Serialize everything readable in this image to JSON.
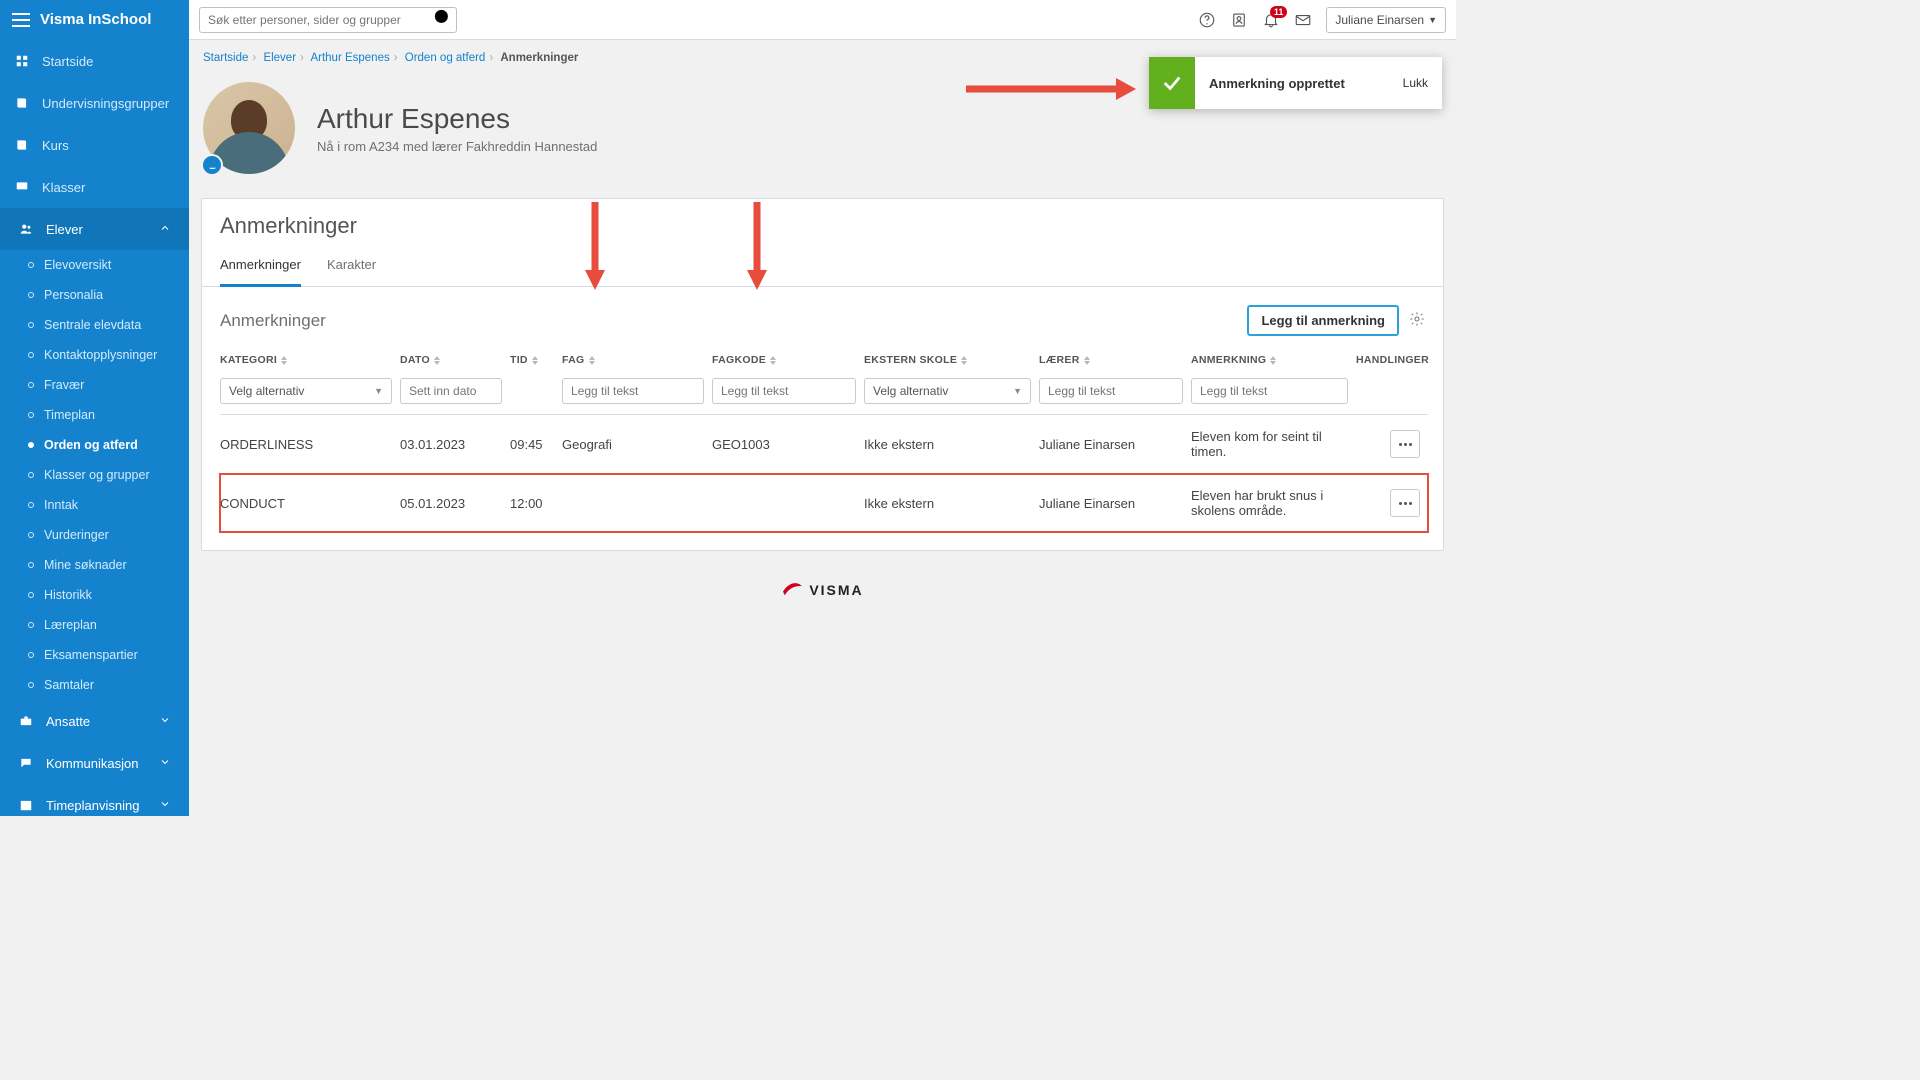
{
  "brand": "Visma InSchool",
  "search": {
    "placeholder": "Søk etter personer, sider og grupper"
  },
  "topbar": {
    "notification_count": "11",
    "user_name": "Juliane Einarsen"
  },
  "toast": {
    "message": "Anmerkning opprettet",
    "close": "Lukk"
  },
  "sidebar": {
    "top": [
      {
        "id": "startside",
        "label": "Startside",
        "icon": "grid"
      },
      {
        "id": "undervisningsgrupper",
        "label": "Undervisningsgrupper",
        "icon": "book"
      },
      {
        "id": "kurs",
        "label": "Kurs",
        "icon": "book"
      },
      {
        "id": "klasser",
        "label": "Klasser",
        "icon": "screen"
      }
    ],
    "elever_label": "Elever",
    "elever_sub": [
      {
        "id": "elevoversikt",
        "label": "Elevoversikt"
      },
      {
        "id": "personalia",
        "label": "Personalia"
      },
      {
        "id": "sentrale-elevdata",
        "label": "Sentrale elevdata"
      },
      {
        "id": "kontaktopplysninger",
        "label": "Kontaktopplysninger"
      },
      {
        "id": "fravaer",
        "label": "Fravær"
      },
      {
        "id": "timeplan",
        "label": "Timeplan"
      },
      {
        "id": "orden-og-atferd",
        "label": "Orden og atferd",
        "active": true
      },
      {
        "id": "klasser-og-grupper",
        "label": "Klasser og grupper"
      },
      {
        "id": "inntak",
        "label": "Inntak"
      },
      {
        "id": "vurderinger",
        "label": "Vurderinger"
      },
      {
        "id": "mine-soknader",
        "label": "Mine søknader"
      },
      {
        "id": "historikk",
        "label": "Historikk"
      },
      {
        "id": "laereplan",
        "label": "Læreplan"
      },
      {
        "id": "eksamenspartier",
        "label": "Eksamenspartier"
      },
      {
        "id": "samtaler",
        "label": "Samtaler"
      }
    ],
    "bottom": [
      {
        "id": "ansatte",
        "label": "Ansatte",
        "icon": "briefcase"
      },
      {
        "id": "kommunikasjon",
        "label": "Kommunikasjon",
        "icon": "chat"
      },
      {
        "id": "timeplanvisning",
        "label": "Timeplanvisning",
        "icon": "calendar"
      }
    ]
  },
  "breadcrumb": {
    "items": [
      "Startside",
      "Elever",
      "Arthur Espenes",
      "Orden og atferd"
    ],
    "current": "Anmerkninger"
  },
  "profile": {
    "name": "Arthur Espenes",
    "subtitle": "Nå i rom A234 med lærer Fakhreddin Hannestad"
  },
  "page_title": "Anmerkninger",
  "tabs": {
    "t0": "Anmerkninger",
    "t1": "Karakter"
  },
  "section": {
    "title": "Anmerkninger",
    "add_button": "Legg til anmerkning"
  },
  "table": {
    "headers": {
      "kategori": "KATEGORI",
      "dato": "DATO",
      "tid": "TID",
      "fag": "FAG",
      "fagkode": "FAGKODE",
      "ekstern": "EKSTERN SKOLE",
      "laerer": "LÆRER",
      "anmerkning": "ANMERKNING",
      "handlinger": "HANDLINGER"
    },
    "filters": {
      "select_placeholder": "Velg alternativ",
      "date_placeholder": "Sett inn dato",
      "text_placeholder": "Legg til tekst"
    },
    "rows": [
      {
        "kategori": "ORDERLINESS",
        "dato": "03.01.2023",
        "tid": "09:45",
        "fag": "Geografi",
        "fagkode": "GEO1003",
        "ekstern": "Ikke ekstern",
        "laerer": "Juliane Einarsen",
        "anmerkning": "Eleven kom for seint til timen."
      },
      {
        "kategori": "CONDUCT",
        "dato": "05.01.2023",
        "tid": "12:00",
        "fag": "",
        "fagkode": "",
        "ekstern": "Ikke ekstern",
        "laerer": "Juliane Einarsen",
        "anmerkning": "Eleven har brukt snus i skolens område."
      }
    ]
  },
  "footer_brand": "VISMA"
}
